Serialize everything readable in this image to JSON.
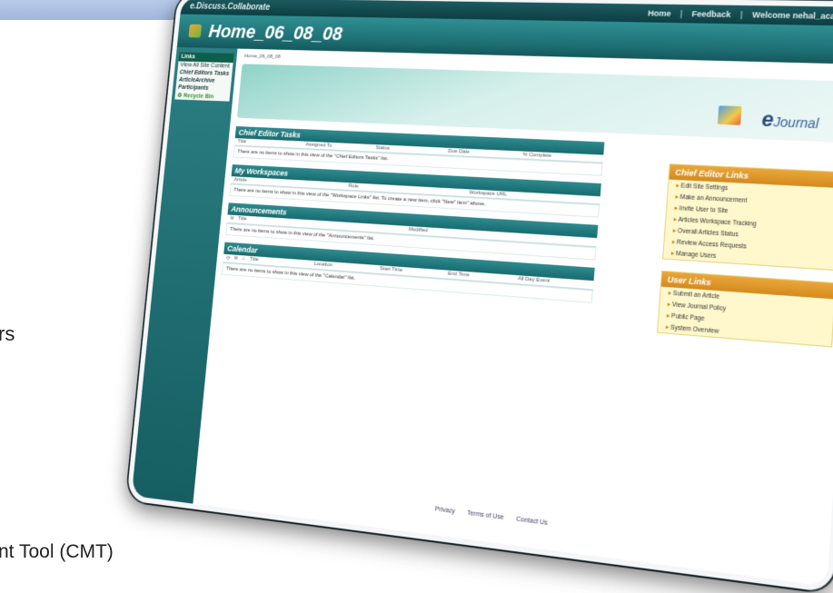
{
  "slide": {
    "fragment_top": "rs",
    "fragment_bottom": "nt Tool (CMT)"
  },
  "app": {
    "brand": "e.Discuss.Collaborate",
    "top_nav": [
      "Home",
      "Feedback",
      "Welcome nehal_aca@..."
    ],
    "site_title": "Home_06_08_08"
  },
  "left_nav": {
    "heading": "Links",
    "items": [
      "View All Site Content",
      "Chief Editors Tasks",
      "ArticleArchive",
      "Participants",
      "Recycle Bin"
    ]
  },
  "breadcrumb": "Home_06_08_08",
  "logo": {
    "prefix": "e",
    "text": "Journal"
  },
  "webparts": [
    {
      "title": "Chief Editor Tasks",
      "columns": [
        "Title",
        "Assigned To",
        "Status",
        "Due Date",
        "% Complete"
      ],
      "empty_msg": "There are no items to show in this view of the \"Chief Editors Tasks\" list."
    },
    {
      "title": "My Workspaces",
      "columns": [
        "Article",
        "Role",
        "Workspace URL"
      ],
      "empty_msg": "There are no items to show in this view of the \"Workspace Links\" list. To create a new item, click \"New\" item\" above."
    },
    {
      "title": "Announcements",
      "columns": [
        "Title",
        "Modified"
      ],
      "empty_msg": "There are no items to show in this view of the \"Announcements\" list."
    },
    {
      "title": "Calendar",
      "columns": [
        "Title",
        "Location",
        "Start Time",
        "End Time",
        "All Day Event"
      ],
      "empty_msg": "There are no items to show in this view of the \"Calendar\" list."
    }
  ],
  "chief_editor_links": {
    "title": "Chief Editor Links",
    "items": [
      "Edit Site Settings",
      "Make an Announcement",
      "Invite User to Site",
      "Articles Workspace Tracking",
      "Overall Articles Status",
      "Review Access Requests",
      "Manage Users"
    ]
  },
  "user_links": {
    "title": "User Links",
    "items": [
      "Submit an Article",
      "View Journal Policy",
      "Public Page",
      "System Overview"
    ]
  },
  "footer": [
    "Privacy",
    "Terms of Use",
    "Contact Us"
  ]
}
